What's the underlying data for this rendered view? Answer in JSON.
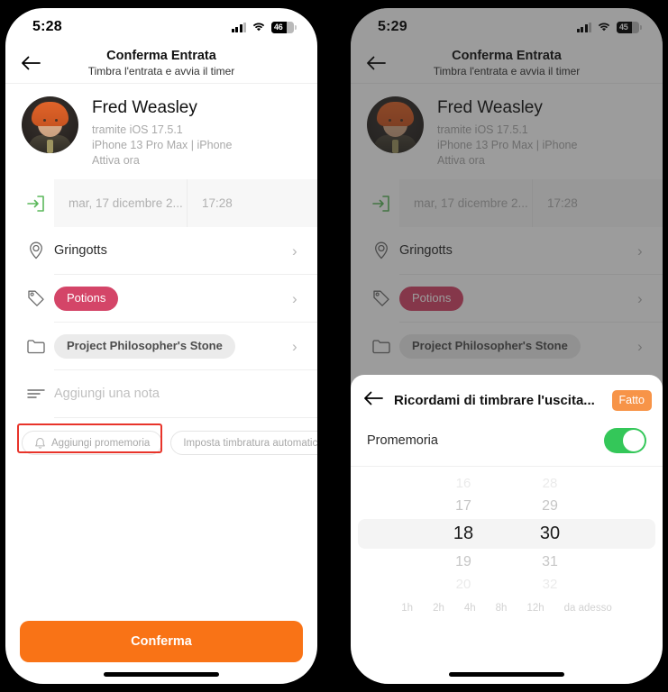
{
  "left_phone": {
    "status_bar": {
      "time": "5:28",
      "battery_level": "46",
      "signal_icon": "cellular-signal-icon",
      "wifi_icon": "wifi-icon"
    },
    "nav": {
      "back_icon": "back-arrow-icon",
      "title": "Conferma Entrata",
      "subtitle": "Timbra l'entrata e avvia il timer"
    },
    "profile": {
      "avatar_icon": "user-avatar-photo",
      "name": "Fred Weasley",
      "via": "tramite iOS 17.5.1",
      "device": "iPhone 13 Pro Max | iPhone",
      "status": "Attiva ora"
    },
    "rows": {
      "datetime": {
        "icon": "clock-in-arrow-icon",
        "date": "mar, 17 dicembre 2...",
        "time": "17:28"
      },
      "location": {
        "icon": "location-pin-icon",
        "value": "Gringotts",
        "chevron": "chevron-right-icon"
      },
      "tag": {
        "icon": "tag-icon",
        "value": "Potions",
        "chevron": "chevron-right-icon",
        "color": "#d44568"
      },
      "project": {
        "icon": "folder-icon",
        "value": "Project Philosopher's Stone",
        "chevron": "chevron-right-icon"
      },
      "note": {
        "icon": "note-lines-icon",
        "placeholder": "Aggiungi una nota"
      }
    },
    "chips": [
      {
        "icon": "bell-reminder-icon",
        "label": "Aggiungi promemoria",
        "highlighted": true
      },
      {
        "icon": "",
        "label": "Imposta timbratura automatica",
        "highlighted": false
      }
    ],
    "confirm_button": {
      "label": "Conferma",
      "color": "#f97316"
    }
  },
  "right_phone": {
    "status_bar": {
      "time": "5:29",
      "battery_level": "45",
      "signal_icon": "cellular-signal-icon",
      "wifi_icon": "wifi-icon"
    },
    "nav": {
      "back_icon": "back-arrow-icon",
      "title": "Conferma Entrata",
      "subtitle": "Timbra l'entrata e avvia il timer"
    },
    "profile": {
      "avatar_icon": "user-avatar-photo",
      "name": "Fred Weasley",
      "via": "tramite iOS 17.5.1",
      "device": "iPhone 13 Pro Max | iPhone",
      "status": "Attiva ora"
    },
    "rows": {
      "location": {
        "icon": "location-pin-icon",
        "value": "Gringotts",
        "chevron": "chevron-right-icon"
      },
      "tag": {
        "icon": "tag-icon",
        "value": "Potions",
        "chevron": "chevron-right-icon"
      },
      "project": {
        "icon": "folder-icon",
        "value": "Project Philosopher's Stone",
        "chevron": "chevron-right-icon"
      },
      "datetime": {
        "icon": "clock-in-arrow-icon",
        "date": "mar, 17 dicembre 2...",
        "time": "17:28"
      }
    },
    "sheet": {
      "back_icon": "back-arrow-icon",
      "title": "Ricordami di timbrare l'uscita...",
      "done_label": "Fatto",
      "done_color": "#f79448",
      "toggle_label": "Promemoria",
      "toggle_on": true,
      "toggle_color": "#34c759",
      "picker": {
        "hours": {
          "above2": "16",
          "above1": "17",
          "selected": "18",
          "below1": "19",
          "below2": "20"
        },
        "minutes": {
          "above2": "28",
          "above1": "29",
          "selected": "30",
          "below1": "31",
          "below2": "32"
        }
      },
      "quick_options": [
        "1h",
        "2h",
        "4h",
        "8h",
        "12h",
        "da adesso"
      ]
    }
  }
}
